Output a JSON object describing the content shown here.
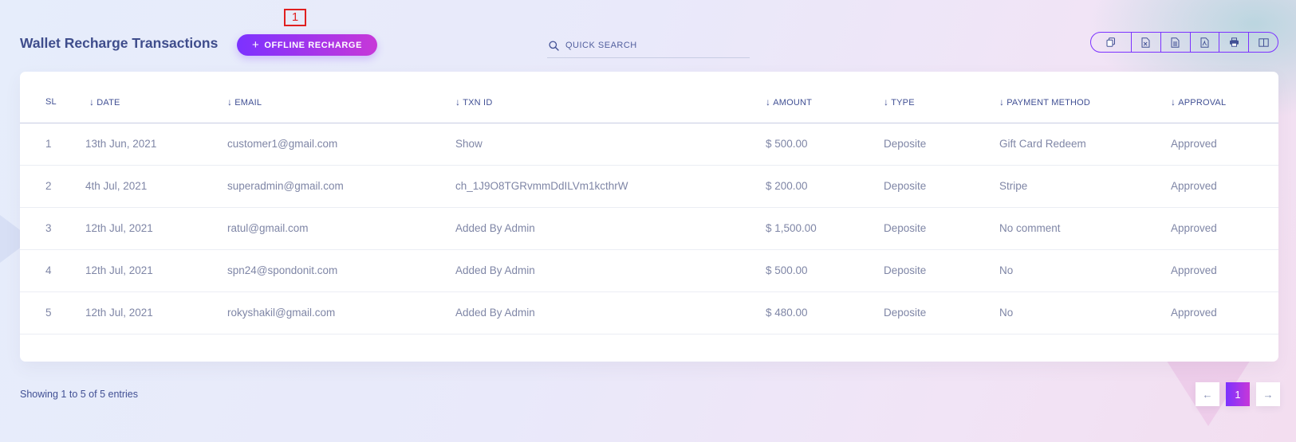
{
  "annotation": {
    "marker": "1"
  },
  "header": {
    "title": "Wallet Recharge Transactions",
    "add_button_label": "OFFLINE RECHARGE",
    "add_button_icon": "+",
    "search_placeholder": "QUICK SEARCH"
  },
  "export_buttons": [
    "copy-icon",
    "excel-icon",
    "csv-icon",
    "pdf-icon",
    "print-icon",
    "columns-icon"
  ],
  "table": {
    "columns": [
      "SL",
      "DATE",
      "EMAIL",
      "TXN ID",
      "AMOUNT",
      "TYPE",
      "PAYMENT METHOD",
      "APPROVAL"
    ],
    "sort_arrow": "↓",
    "rows": [
      {
        "sl": "1",
        "date": "13th Jun, 2021",
        "email": "customer1@gmail.com",
        "txn": "Show",
        "amount": "$ 500.00",
        "type": "Deposite",
        "method": "Gift Card Redeem",
        "approval": "Approved"
      },
      {
        "sl": "2",
        "date": "4th Jul, 2021",
        "email": "superadmin@gmail.com",
        "txn": "ch_1J9O8TGRvmmDdILVm1kcthrW",
        "amount": "$ 200.00",
        "type": "Deposite",
        "method": "Stripe",
        "approval": "Approved"
      },
      {
        "sl": "3",
        "date": "12th Jul, 2021",
        "email": "ratul@gmail.com",
        "txn": "Added By Admin",
        "amount": "$ 1,500.00",
        "type": "Deposite",
        "method": "No comment",
        "approval": "Approved"
      },
      {
        "sl": "4",
        "date": "12th Jul, 2021",
        "email": "spn24@spondonit.com",
        "txn": "Added By Admin",
        "amount": "$ 500.00",
        "type": "Deposite",
        "method": "No",
        "approval": "Approved"
      },
      {
        "sl": "5",
        "date": "12th Jul, 2021",
        "email": "rokyshakil@gmail.com",
        "txn": "Added By Admin",
        "amount": "$ 480.00",
        "type": "Deposite",
        "method": "No",
        "approval": "Approved"
      }
    ]
  },
  "footer": {
    "info": "Showing 1 to 5 of 5 entries",
    "pagination": {
      "prev": "←",
      "current": "1",
      "next": "→"
    }
  },
  "colors": {
    "accent_start": "#7c32ff",
    "accent_end": "#c738d8",
    "text": "#415094",
    "muted": "#7f86a6"
  }
}
